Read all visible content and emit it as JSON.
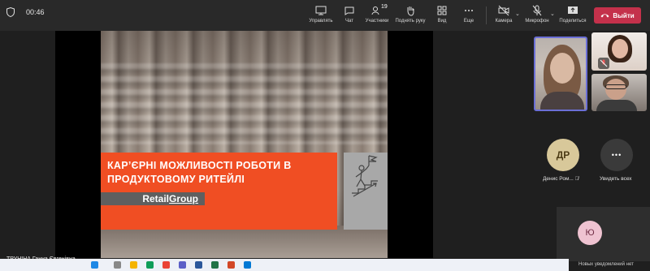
{
  "meeting": {
    "timer": "00:46"
  },
  "toolbar": {
    "present_label": "Управлять",
    "chat_label": "Чат",
    "participants_label": "Участники",
    "participants_count": "19",
    "raise_hand_label": "Поднять руку",
    "view_label": "Вид",
    "more_label": "Еще",
    "camera_label": "Камера",
    "mic_label": "Микрофон",
    "share_label": "Поделиться",
    "leave_label": "Выйти"
  },
  "slide": {
    "title": "Кар’єрні можливості роботи в продуктовому ритейлі",
    "brand_part1": "Retail",
    "brand_part2": "Group"
  },
  "participants": {
    "denis_initials": "ДР",
    "denis_name": "Денис Ром...",
    "see_all_label": "Увидеть всех",
    "more_symbol": "•••",
    "u_initial": "Ю"
  },
  "presenter_name": "ТРУНІНА Ганна Євгенівна",
  "notifications": "Новых уведомлений нет",
  "colors": {
    "leave_red": "#c4314b",
    "slide_red": "#f04e23",
    "active_speaker": "#6b6fd6"
  }
}
